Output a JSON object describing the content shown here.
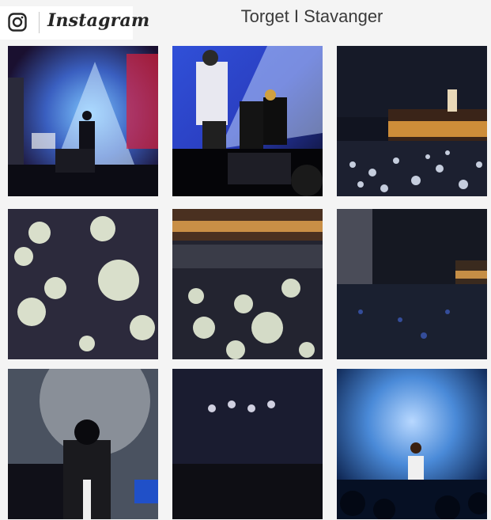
{
  "header": {
    "brand": "Instagram",
    "icon": "instagram-icon",
    "location_title": "Torget I Stavanger"
  },
  "photos": [
    {
      "name": "concert-stage-spotlight-photo",
      "subject": "concert"
    },
    {
      "name": "rapper-on-stage-photo",
      "subject": "concert"
    },
    {
      "name": "night-square-snowflake-lights-photo",
      "subject": "square"
    },
    {
      "name": "snowflake-projection-closeup-photo",
      "subject": "snowflakes"
    },
    {
      "name": "stairs-snowflake-lights-photo",
      "subject": "square"
    },
    {
      "name": "harbor-night-view-photo",
      "subject": "harbor"
    },
    {
      "name": "singer-with-microphone-photo",
      "subject": "concert"
    },
    {
      "name": "confetti-crowd-concert-photo",
      "subject": "concert"
    },
    {
      "name": "guitarist-blue-stage-photo",
      "subject": "concert"
    }
  ],
  "colors": {
    "header_bg": "#f4f4f4",
    "text": "#3a3a3a",
    "stage_blue": "#2a6ad8",
    "snow_light": "#e8efd8"
  }
}
